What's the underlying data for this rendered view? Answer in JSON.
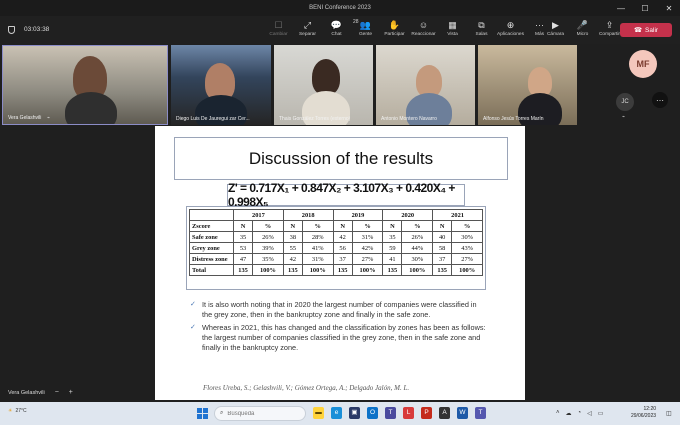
{
  "window": {
    "title": "BENI Conference 2023"
  },
  "toolbar": {
    "timer": "03:03:38",
    "tools": [
      {
        "label": "Cambiar",
        "icon": "☐",
        "dim": true
      },
      {
        "label": "Separar",
        "icon": "⤢",
        "dim": false
      },
      {
        "label": "Chat",
        "icon": "💬",
        "dim": false
      },
      {
        "label": "Gente",
        "icon": "👥",
        "badge": "28",
        "dim": false
      },
      {
        "label": "Participar",
        "icon": "✋",
        "dim": false
      },
      {
        "label": "Reaccionar",
        "icon": "☺",
        "dim": false
      },
      {
        "label": "Vista",
        "icon": "▦",
        "dim": false
      },
      {
        "label": "Salas",
        "icon": "⧉",
        "dim": false
      },
      {
        "label": "Aplicaciones",
        "icon": "⊕",
        "dim": false
      },
      {
        "label": "Más",
        "icon": "···",
        "dim": false
      }
    ],
    "right_tools": [
      {
        "label": "Cámara",
        "icon": "▶"
      },
      {
        "label": "Micro",
        "icon": "🎤"
      },
      {
        "label": "Compartir",
        "icon": "⇪"
      }
    ],
    "leave_label": "Salir"
  },
  "participants": [
    {
      "name": "Vera Gelashvili"
    },
    {
      "name": "Diego Luis De Jauregui zar Cer..."
    },
    {
      "name": "Thais González Torres (externo)"
    },
    {
      "name": "Antonio Montero Navarro"
    },
    {
      "name": "Alfonso Jesús Torres Marín"
    }
  ],
  "avatars": {
    "mf": "MF",
    "jc": "JC"
  },
  "slide": {
    "title": "Discussion of the results",
    "formula": "Z' = 0.717X₁ + 0.847X₂ + 3.107X₃ + 0.420X₄ + 0.998X₅",
    "table": {
      "years": [
        "2017",
        "2018",
        "2019",
        "2020",
        "2021"
      ],
      "row_header": "Zscore",
      "sub_headers": [
        "N",
        "%"
      ],
      "rows": [
        {
          "label": "Safe zone",
          "cells": [
            "35",
            "26%",
            "38",
            "28%",
            "42",
            "31%",
            "35",
            "26%",
            "40",
            "30%"
          ]
        },
        {
          "label": "Grey zone",
          "cells": [
            "53",
            "39%",
            "55",
            "41%",
            "56",
            "42%",
            "59",
            "44%",
            "58",
            "43%"
          ]
        },
        {
          "label": "Distress zone",
          "cells": [
            "47",
            "35%",
            "42",
            "31%",
            "37",
            "27%",
            "41",
            "30%",
            "37",
            "27%"
          ]
        },
        {
          "label": "Total",
          "cells": [
            "135",
            "100%",
            "135",
            "100%",
            "135",
            "100%",
            "135",
            "100%",
            "135",
            "100%"
          ]
        }
      ]
    },
    "bullets": [
      "It is also worth noting that in 2020 the largest number of companies were classified in the grey zone, then in the bankruptcy zone and finally in the safe zone.",
      "Whereas in 2021, this has changed and the classification by zones has been as follows: the largest number of companies classified in the grey zone, then in the safe zone and finally in the bankruptcy zone."
    ],
    "citation": "Flores Ureba, S.; Gelashvili, V.; Gómez Ortega, A.; Delgado Jalón, M. L."
  },
  "presenter": {
    "name": "Vera Gelashvili",
    "zoom_out": "−",
    "zoom_in": "+"
  },
  "taskbar": {
    "search_placeholder": "Búsqueda",
    "time": "12:20",
    "date": "29/06/2023",
    "weather": "27°C"
  }
}
